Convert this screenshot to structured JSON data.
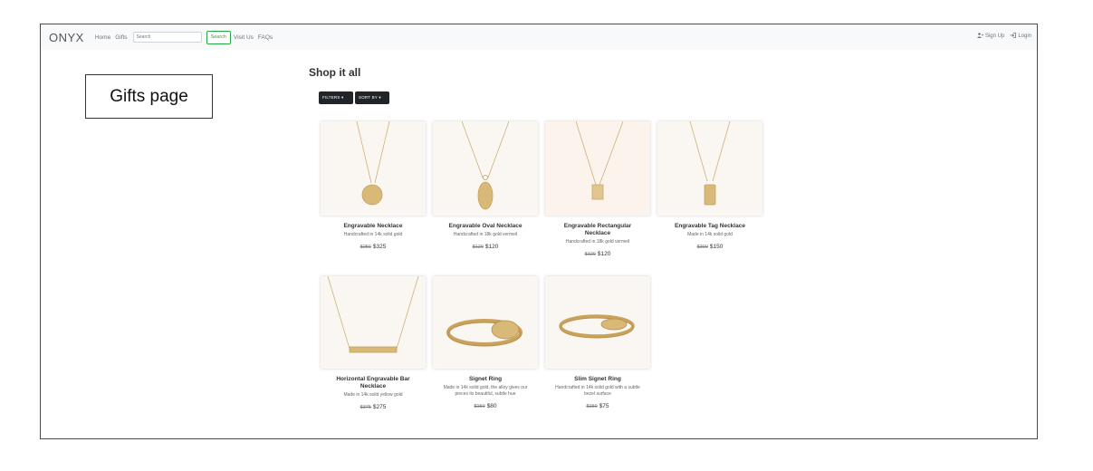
{
  "navbar": {
    "brand": "ONYX",
    "links": [
      "Home",
      "Gifts"
    ],
    "search_placeholder": "Search",
    "search_button": "Search",
    "links_after": [
      "Visit Us",
      "FAQs"
    ],
    "signup": "Sign Up",
    "login": "Login"
  },
  "annotation": "Gifts page",
  "main": {
    "title": "Shop it all",
    "filters_label": "FILTERS ▾",
    "sort_label": "SORT BY ▾",
    "products": [
      {
        "name": "Engravable Necklace",
        "desc": "Handcrafted in 14k solid gold",
        "old_price": "$250",
        "price": "$325",
        "pendant": "disc"
      },
      {
        "name": "Engravable Oval Necklace",
        "desc": "Handcrafted in 18k gold vermeil",
        "old_price": "$120",
        "price": "$120",
        "pendant": "oval"
      },
      {
        "name": "Engravable Rectangular Necklace",
        "desc": "Handcrafted in 18k gold vermeil",
        "old_price": "$120",
        "price": "$120",
        "pendant": "rect"
      },
      {
        "name": "Engravable Tag Necklace",
        "desc": "Made in 14k solid gold",
        "old_price": "$300",
        "price": "$150",
        "pendant": "tag"
      },
      {
        "name": "Horizontal Engravable Bar Necklace",
        "desc": "Made in 14k solid yellow gold",
        "old_price": "$375",
        "price": "$275",
        "pendant": "bar"
      },
      {
        "name": "Signet Ring",
        "desc": "Made in 14k solid gold, the alloy gives our pieces its beautiful, subtle hue",
        "old_price": "$150",
        "price": "$80",
        "pendant": "signet"
      },
      {
        "name": "Slim Signet Ring",
        "desc": "Handcrafted in 14k solid gold with a subtle bezel surface",
        "old_price": "$150",
        "price": "$75",
        "pendant": "slim-signet"
      }
    ]
  }
}
